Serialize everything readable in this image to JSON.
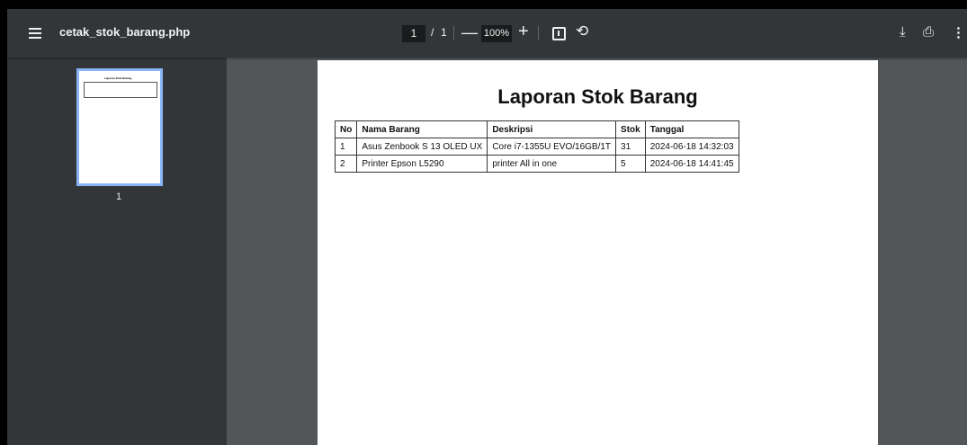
{
  "toolbar": {
    "title": "cetak_stok_barang.php",
    "page_current": "1",
    "page_separator": "/",
    "page_total": "1",
    "zoom_out": "—",
    "zoom_value": "100%",
    "zoom_in": "+",
    "rotate_glyph": "⟲",
    "download_glyph": "⤓",
    "print_glyph": "⎙",
    "more_glyph": "⋮"
  },
  "icons": [
    "menu-icon",
    "fit-page-icon",
    "rotate-icon",
    "download-icon",
    "print-icon",
    "more-icon"
  ],
  "sidebar": {
    "thumbnail_label": "1"
  },
  "document": {
    "title": "Laporan Stok Barang",
    "columns": [
      "No",
      "Nama Barang",
      "Deskripsi",
      "Stok",
      "Tanggal"
    ],
    "rows": [
      [
        "1",
        "Asus Zenbook S 13 OLED UX",
        "Core i7-1355U EVO/16GB/1T",
        "31",
        "2024-06-18 14:32:03"
      ],
      [
        "2",
        "Printer Epson L5290",
        "printer All in one",
        "5",
        "2024-06-18 14:41:45"
      ]
    ]
  },
  "colors": {
    "toolbar_bg": "#323639",
    "viewer_bg": "#525659",
    "thumb_selected": "#8ab4f8"
  }
}
